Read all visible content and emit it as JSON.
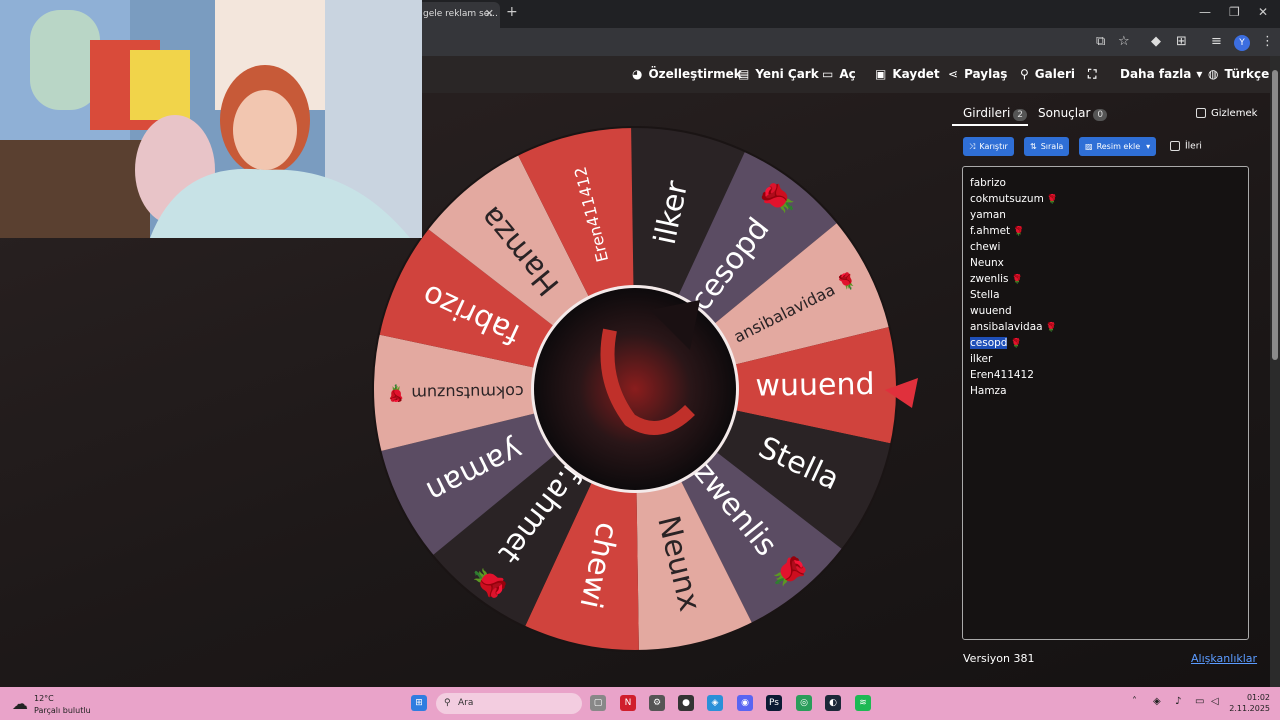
{
  "browser": {
    "tab_title": "gele reklam se...",
    "new_tab": "+",
    "profile_initial": "Y"
  },
  "nav": {
    "customize": "Özelleştirmek",
    "new_wheel": "Yeni Çark",
    "open": "Aç",
    "save": "Kaydet",
    "share": "Paylaş",
    "gallery": "Galeri",
    "more": "Daha fazla",
    "language": "Türkçe"
  },
  "wheel": {
    "segments": [
      {
        "label": "ilker",
        "color": "#2a2325",
        "rose": false
      },
      {
        "label": "cesopd",
        "color": "#5b4c63",
        "rose": true
      },
      {
        "label": "ansibalavidaa",
        "color": "#e3a9a0",
        "rose": true
      },
      {
        "label": "wuuend",
        "color": "#d0433d",
        "rose": false
      },
      {
        "label": "Stella",
        "color": "#2a2325",
        "rose": false
      },
      {
        "label": "zwenlis",
        "color": "#5b4c63",
        "rose": true
      },
      {
        "label": "Neunx",
        "color": "#e3a9a0",
        "rose": false
      },
      {
        "label": "chewi",
        "color": "#d0433d",
        "rose": false
      },
      {
        "label": "f.ahmet",
        "color": "#2a2325",
        "rose": true
      },
      {
        "label": "yaman",
        "color": "#5b4c63",
        "rose": false
      },
      {
        "label": "cokmutsuzum",
        "color": "#e3a9a0",
        "rose": true
      },
      {
        "label": "fabrizo",
        "color": "#d0433d",
        "rose": false
      },
      {
        "label": "Hamza",
        "color": "#e3a9a0",
        "rose": false
      },
      {
        "label": "Eren411412",
        "color": "#d0433d",
        "rose": false
      }
    ],
    "pointer_color": "#e0303c"
  },
  "panel": {
    "entries_tab": "Girdileri",
    "entries_count": "2",
    "results_tab": "Sonuçlar",
    "results_count": "0",
    "hide_label": "Gizlemek",
    "shuffle": "Karıştır",
    "sort": "Sırala",
    "add_image": "Resim ekle",
    "advanced": "İleri",
    "entries": [
      {
        "text": "fabrizo",
        "rose": false,
        "selected": false
      },
      {
        "text": "cokmutsuzum",
        "rose": true,
        "selected": false
      },
      {
        "text": "yaman",
        "rose": false,
        "selected": false
      },
      {
        "text": "f.ahmet",
        "rose": true,
        "selected": false
      },
      {
        "text": "chewi",
        "rose": false,
        "selected": false
      },
      {
        "text": "Neunx",
        "rose": false,
        "selected": false
      },
      {
        "text": "zwenlis",
        "rose": true,
        "selected": false
      },
      {
        "text": "Stella",
        "rose": false,
        "selected": false
      },
      {
        "text": "wuuend",
        "rose": false,
        "selected": false
      },
      {
        "text": "ansibalavidaa",
        "rose": true,
        "selected": false
      },
      {
        "text": "cesopd",
        "rose": true,
        "selected": true
      },
      {
        "text": "ilker",
        "rose": false,
        "selected": false
      },
      {
        "text": "Eren411412",
        "rose": false,
        "selected": false
      },
      {
        "text": "Hamza",
        "rose": false,
        "selected": false
      }
    ],
    "version": "Versiyon 381",
    "shortcuts": "Alışkanlıklar"
  },
  "taskbar": {
    "temperature": "12°C",
    "weather_desc": "Parçalı bulutlu",
    "search_placeholder": "Ara",
    "time": "01:02",
    "date": "2.11.2025"
  }
}
